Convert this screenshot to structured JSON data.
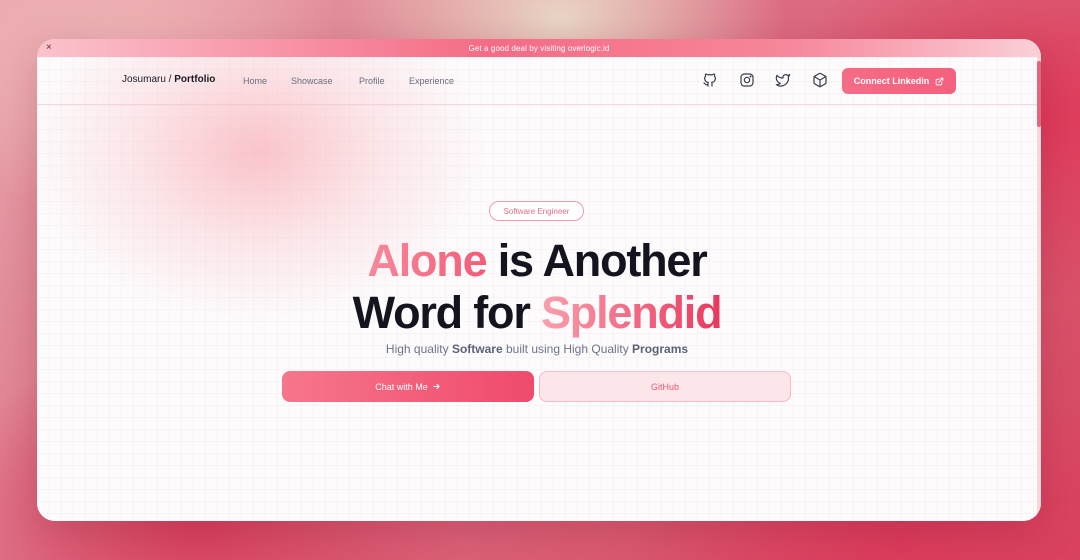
{
  "announcement": {
    "text": "Get a good deal by visiting overlogic.id",
    "close_glyph": "×"
  },
  "nav": {
    "brand_name": "Josumaru",
    "brand_separator": " / ",
    "brand_section": "Portfolio",
    "links": [
      "Home",
      "Showcase",
      "Profile",
      "Experience"
    ],
    "icons": [
      "github-icon",
      "instagram-icon",
      "twitter-icon",
      "box-icon"
    ],
    "cta_label": "Connect Linkedin",
    "cta_icon": "external-link-icon"
  },
  "hero": {
    "badge": "Software Engineer",
    "headline": {
      "line1_accent": "Alone",
      "line1_rest": " is Another",
      "line2_start": "Word for ",
      "line2_accent": "Splendid"
    },
    "subline": {
      "part1": "High quality ",
      "bold1": "Software",
      "part2": " built using High Quality ",
      "bold2": "Programs"
    },
    "primary_button": "Chat with Me",
    "primary_button_icon": "arrow-right-icon",
    "secondary_button": "GitHub"
  },
  "colors": {
    "accent": "#f4607d",
    "accent_light": "#fde6ea",
    "text_dark": "#15131d",
    "text_muted": "#6c7488"
  }
}
